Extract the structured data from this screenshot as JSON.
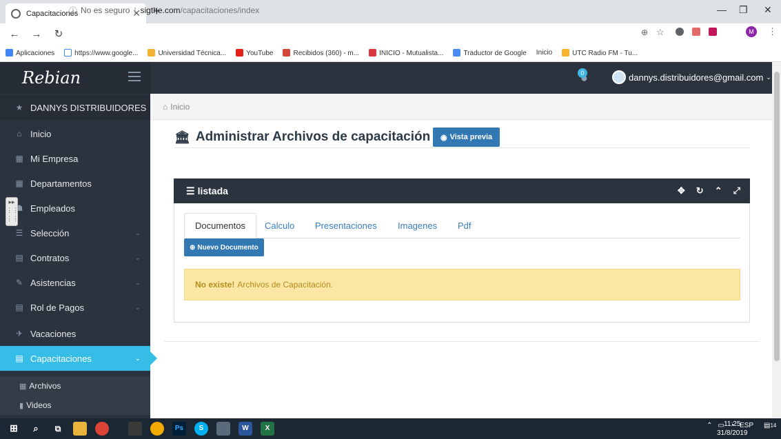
{
  "browser": {
    "tab_title": "Capacitaciones",
    "address_security": "No es seguro",
    "address_host": "sigthe.com",
    "address_path": "/capacitaciones/index",
    "bookmarks": [
      "Aplicaciones",
      "https://www.google...",
      "Universidad Técnica...",
      "YouTube",
      "Recibidos (360) - m...",
      "INICIO - Mutualista...",
      "Traductor de Google",
      "Inicio",
      "UTC Radio FM - Tu..."
    ]
  },
  "header": {
    "logo_text": "Rebian",
    "notification_count": "0",
    "user_email": "dannys.distribuidores@gmail.com"
  },
  "sidebar": {
    "company": "DANNYS DISTRIBUIDORES",
    "items": [
      "Inicio",
      "Mi Empresa",
      "Departamentos",
      "Empleados",
      "Selección",
      "Contratos",
      "Asistencias",
      "Rol de Pagos",
      "Vacaciones",
      "Capacitaciones"
    ],
    "sub_items": [
      "Archivos",
      "Videos"
    ]
  },
  "main": {
    "breadcrumb": "Inicio",
    "page_title": "Administrar Archivos de capacitación",
    "preview_button": "Vista previa",
    "panel_title": "listada",
    "tabs": [
      "Documentos",
      "Calculo",
      "Presentaciones",
      "Imagenes",
      "Pdf"
    ],
    "new_button": "Nuevo Documento",
    "alert_strong": "No existe!",
    "alert_text": "Archivos de Capacitación."
  },
  "taskbar": {
    "lang": "ESP",
    "time": "11:25",
    "date": "31/8/2019",
    "notifications": "14"
  },
  "colors": {
    "sidebar_bg": "#2b333e",
    "active_item": "#35bde8",
    "primary_button": "#3278b3",
    "alert_bg": "#fbe6a3"
  }
}
